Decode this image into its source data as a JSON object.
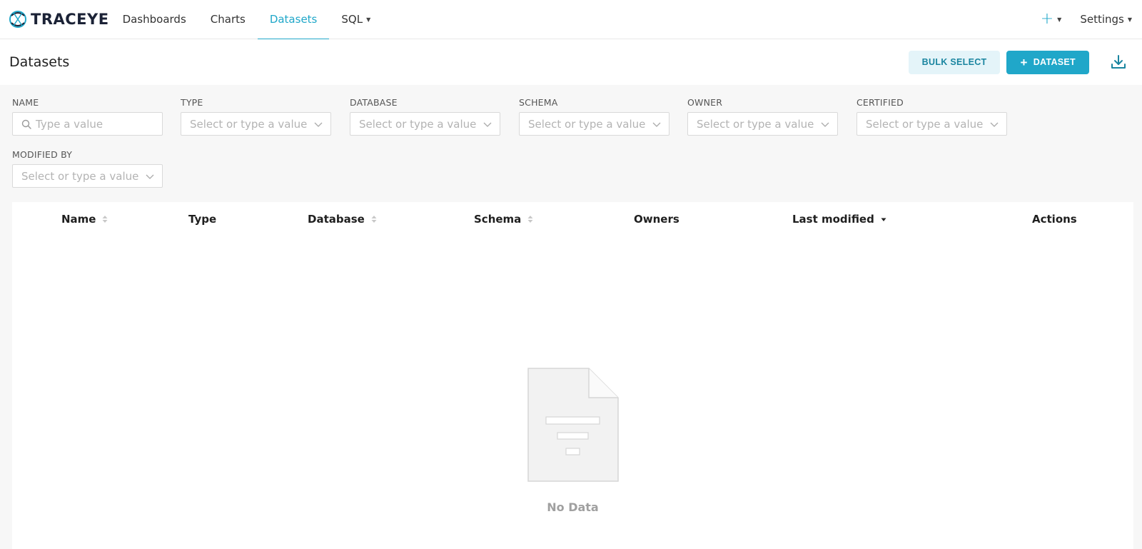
{
  "brand": {
    "name": "TRACEYE",
    "accent": "#20a7c9"
  },
  "nav": {
    "items": [
      {
        "label": "Dashboards",
        "active": false
      },
      {
        "label": "Charts",
        "active": false
      },
      {
        "label": "Datasets",
        "active": true
      },
      {
        "label": "SQL",
        "active": false,
        "has_caret": true
      }
    ],
    "plus_label": "+",
    "settings_label": "Settings"
  },
  "header": {
    "title": "Datasets",
    "bulk_select_label": "BULK SELECT",
    "add_dataset_label": "DATASET",
    "add_dataset_plus": "+"
  },
  "filters": {
    "name": {
      "label": "NAME",
      "placeholder": "Type a value"
    },
    "type": {
      "label": "TYPE",
      "placeholder": "Select or type a value"
    },
    "database": {
      "label": "DATABASE",
      "placeholder": "Select or type a value"
    },
    "schema": {
      "label": "SCHEMA",
      "placeholder": "Select or type a value"
    },
    "owner": {
      "label": "OWNER",
      "placeholder": "Select or type a value"
    },
    "certified": {
      "label": "CERTIFIED",
      "placeholder": "Select or type a value"
    },
    "modified_by": {
      "label": "MODIFIED BY",
      "placeholder": "Select or type a value"
    }
  },
  "table": {
    "columns": [
      {
        "label": "Name",
        "sortable": true
      },
      {
        "label": "Type",
        "sortable": false
      },
      {
        "label": "Database",
        "sortable": true
      },
      {
        "label": "Schema",
        "sortable": true
      },
      {
        "label": "Owners",
        "sortable": false
      },
      {
        "label": "Last modified",
        "sortable": true,
        "sort": "desc"
      },
      {
        "label": "Actions",
        "sortable": false
      }
    ],
    "rows": [],
    "empty_text": "No Data"
  }
}
